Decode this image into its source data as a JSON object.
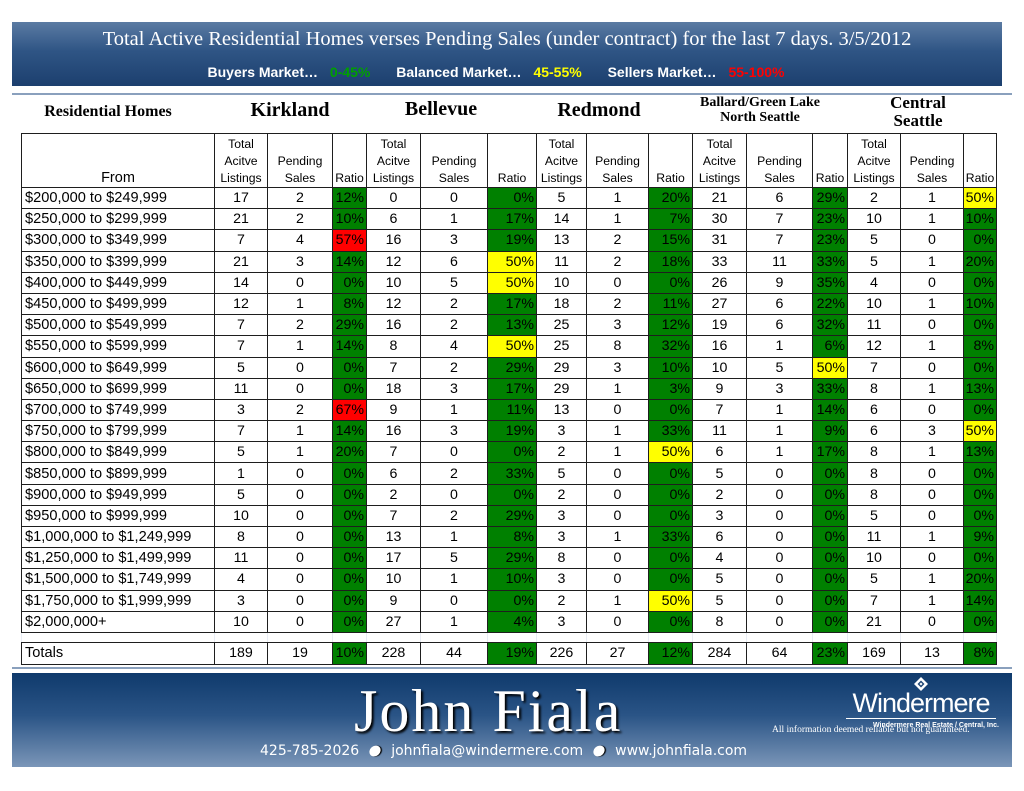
{
  "header": {
    "title": "Total Active Residential Homes verses Pending Sales (under contract) for the last 7 days. 3/5/2012",
    "legend": [
      {
        "label": "Buyers Market…",
        "range": "0-45%",
        "color": "#00a000"
      },
      {
        "label": "Balanced Market…",
        "range": "45-55%",
        "color": "#ffff00"
      },
      {
        "label": "Sellers Market…",
        "range": "55-100%",
        "color": "#ff0000"
      }
    ]
  },
  "table": {
    "section_title": "Residential Homes",
    "cities": [
      "Kirkland",
      "Bellevue",
      "Redmond",
      "Ballard/Green Lake North Seattle",
      "Central Seattle"
    ],
    "city_lines": {
      "ballard_1": "Ballard/Green Lake",
      "ballard_2": "North Seattle",
      "central_1": "Central",
      "central_2": "Seattle"
    },
    "from_header": "From",
    "subheaders": {
      "listings_1": "Total",
      "listings_2": "Acitve",
      "listings_3": "Listings",
      "pending_1": "Pending",
      "pending_2": "Sales",
      "ratio": "Ratio"
    },
    "status_colors": {
      "green": "#008000",
      "yellow": "#ffff00",
      "red": "#ff0000"
    },
    "rows": [
      {
        "range": "$200,000 to $249,999",
        "cells": [
          [
            17,
            2,
            "12%",
            "green"
          ],
          [
            0,
            0,
            "0%",
            "green"
          ],
          [
            5,
            1,
            "20%",
            "green"
          ],
          [
            21,
            6,
            "29%",
            "green"
          ],
          [
            2,
            1,
            "50%",
            "yellow"
          ]
        ]
      },
      {
        "range": "$250,000 to $299,999",
        "cells": [
          [
            21,
            2,
            "10%",
            "green"
          ],
          [
            6,
            1,
            "17%",
            "green"
          ],
          [
            14,
            1,
            "7%",
            "green"
          ],
          [
            30,
            7,
            "23%",
            "green"
          ],
          [
            10,
            1,
            "10%",
            "green"
          ]
        ]
      },
      {
        "range": "$300,000 to $349,999",
        "cells": [
          [
            7,
            4,
            "57%",
            "red"
          ],
          [
            16,
            3,
            "19%",
            "green"
          ],
          [
            13,
            2,
            "15%",
            "green"
          ],
          [
            31,
            7,
            "23%",
            "green"
          ],
          [
            5,
            0,
            "0%",
            "green"
          ]
        ]
      },
      {
        "range": "$350,000 to $399,999",
        "cells": [
          [
            21,
            3,
            "14%",
            "green"
          ],
          [
            12,
            6,
            "50%",
            "yellow"
          ],
          [
            11,
            2,
            "18%",
            "green"
          ],
          [
            33,
            11,
            "33%",
            "green"
          ],
          [
            5,
            1,
            "20%",
            "green"
          ]
        ]
      },
      {
        "range": "$400,000 to $449,999",
        "cells": [
          [
            14,
            0,
            "0%",
            "green"
          ],
          [
            10,
            5,
            "50%",
            "yellow"
          ],
          [
            10,
            0,
            "0%",
            "green"
          ],
          [
            26,
            9,
            "35%",
            "green"
          ],
          [
            4,
            0,
            "0%",
            "green"
          ]
        ]
      },
      {
        "range": "$450,000 to $499,999",
        "cells": [
          [
            12,
            1,
            "8%",
            "green"
          ],
          [
            12,
            2,
            "17%",
            "green"
          ],
          [
            18,
            2,
            "11%",
            "green"
          ],
          [
            27,
            6,
            "22%",
            "green"
          ],
          [
            10,
            1,
            "10%",
            "green"
          ]
        ]
      },
      {
        "range": "$500,000 to $549,999",
        "cells": [
          [
            7,
            2,
            "29%",
            "green"
          ],
          [
            16,
            2,
            "13%",
            "green"
          ],
          [
            25,
            3,
            "12%",
            "green"
          ],
          [
            19,
            6,
            "32%",
            "green"
          ],
          [
            11,
            0,
            "0%",
            "green"
          ]
        ]
      },
      {
        "range": "$550,000 to $599,999",
        "cells": [
          [
            7,
            1,
            "14%",
            "green"
          ],
          [
            8,
            4,
            "50%",
            "yellow"
          ],
          [
            25,
            8,
            "32%",
            "green"
          ],
          [
            16,
            1,
            "6%",
            "green"
          ],
          [
            12,
            1,
            "8%",
            "green"
          ]
        ]
      },
      {
        "range": "$600,000 to $649,999",
        "cells": [
          [
            5,
            0,
            "0%",
            "green"
          ],
          [
            7,
            2,
            "29%",
            "green"
          ],
          [
            29,
            3,
            "10%",
            "green"
          ],
          [
            10,
            5,
            "50%",
            "yellow"
          ],
          [
            7,
            0,
            "0%",
            "green"
          ]
        ]
      },
      {
        "range": "$650,000 to $699,999",
        "cells": [
          [
            11,
            0,
            "0%",
            "green"
          ],
          [
            18,
            3,
            "17%",
            "green"
          ],
          [
            29,
            1,
            "3%",
            "green"
          ],
          [
            9,
            3,
            "33%",
            "green"
          ],
          [
            8,
            1,
            "13%",
            "green"
          ]
        ]
      },
      {
        "range": "$700,000 to $749,999",
        "cells": [
          [
            3,
            2,
            "67%",
            "red"
          ],
          [
            9,
            1,
            "11%",
            "green"
          ],
          [
            13,
            0,
            "0%",
            "green"
          ],
          [
            7,
            1,
            "14%",
            "green"
          ],
          [
            6,
            0,
            "0%",
            "green"
          ]
        ]
      },
      {
        "range": "$750,000 to $799,999",
        "cells": [
          [
            7,
            1,
            "14%",
            "green"
          ],
          [
            16,
            3,
            "19%",
            "green"
          ],
          [
            3,
            1,
            "33%",
            "green"
          ],
          [
            11,
            1,
            "9%",
            "green"
          ],
          [
            6,
            3,
            "50%",
            "yellow"
          ]
        ]
      },
      {
        "range": "$800,000 to $849,999",
        "cells": [
          [
            5,
            1,
            "20%",
            "green"
          ],
          [
            7,
            0,
            "0%",
            "green"
          ],
          [
            2,
            1,
            "50%",
            "yellow"
          ],
          [
            6,
            1,
            "17%",
            "green"
          ],
          [
            8,
            1,
            "13%",
            "green"
          ]
        ]
      },
      {
        "range": "$850,000 to $899,999",
        "cells": [
          [
            1,
            0,
            "0%",
            "green"
          ],
          [
            6,
            2,
            "33%",
            "green"
          ],
          [
            5,
            0,
            "0%",
            "green"
          ],
          [
            5,
            0,
            "0%",
            "green"
          ],
          [
            8,
            0,
            "0%",
            "green"
          ]
        ]
      },
      {
        "range": "$900,000 to $949,999",
        "cells": [
          [
            5,
            0,
            "0%",
            "green"
          ],
          [
            2,
            0,
            "0%",
            "green"
          ],
          [
            2,
            0,
            "0%",
            "green"
          ],
          [
            2,
            0,
            "0%",
            "green"
          ],
          [
            8,
            0,
            "0%",
            "green"
          ]
        ]
      },
      {
        "range": "$950,000 to $999,999",
        "cells": [
          [
            10,
            0,
            "0%",
            "green"
          ],
          [
            7,
            2,
            "29%",
            "green"
          ],
          [
            3,
            0,
            "0%",
            "green"
          ],
          [
            3,
            0,
            "0%",
            "green"
          ],
          [
            5,
            0,
            "0%",
            "green"
          ]
        ]
      },
      {
        "range": "$1,000,000 to $1,249,999",
        "cells": [
          [
            8,
            0,
            "0%",
            "green"
          ],
          [
            13,
            1,
            "8%",
            "green"
          ],
          [
            3,
            1,
            "33%",
            "green"
          ],
          [
            6,
            0,
            "0%",
            "green"
          ],
          [
            11,
            1,
            "9%",
            "green"
          ]
        ]
      },
      {
        "range": "$1,250,000 to $1,499,999",
        "cells": [
          [
            11,
            0,
            "0%",
            "green"
          ],
          [
            17,
            5,
            "29%",
            "green"
          ],
          [
            8,
            0,
            "0%",
            "green"
          ],
          [
            4,
            0,
            "0%",
            "green"
          ],
          [
            10,
            0,
            "0%",
            "green"
          ]
        ]
      },
      {
        "range": "$1,500,000 to $1,749,999",
        "cells": [
          [
            4,
            0,
            "0%",
            "green"
          ],
          [
            10,
            1,
            "10%",
            "green"
          ],
          [
            3,
            0,
            "0%",
            "green"
          ],
          [
            5,
            0,
            "0%",
            "green"
          ],
          [
            5,
            1,
            "20%",
            "green"
          ]
        ]
      },
      {
        "range": "$1,750,000 to $1,999,999",
        "cells": [
          [
            3,
            0,
            "0%",
            "green"
          ],
          [
            9,
            0,
            "0%",
            "green"
          ],
          [
            2,
            1,
            "50%",
            "yellow"
          ],
          [
            5,
            0,
            "0%",
            "green"
          ],
          [
            7,
            1,
            "14%",
            "green"
          ]
        ]
      },
      {
        "range": "$2,000,000+",
        "cells": [
          [
            10,
            0,
            "0%",
            "green"
          ],
          [
            27,
            1,
            "4%",
            "green"
          ],
          [
            3,
            0,
            "0%",
            "green"
          ],
          [
            8,
            0,
            "0%",
            "green"
          ],
          [
            21,
            0,
            "0%",
            "green"
          ]
        ]
      }
    ],
    "totals": {
      "label": "Totals",
      "cells": [
        [
          189,
          19,
          "10%",
          "green"
        ],
        [
          228,
          44,
          "19%",
          "green"
        ],
        [
          226,
          27,
          "12%",
          "green"
        ],
        [
          284,
          64,
          "23%",
          "green"
        ],
        [
          169,
          13,
          "8%",
          "green"
        ]
      ]
    }
  },
  "footer": {
    "agent_name": "John Fiala",
    "phone": "425-785-2026",
    "email": "johnfiala@windermere.com",
    "website": "www.johnfiala.com",
    "brand": "Windermere",
    "brand_sub": "Windermere Real Estate / Central, Inc.",
    "disclaimer": "All information deemed reliable but not guaranteed."
  }
}
